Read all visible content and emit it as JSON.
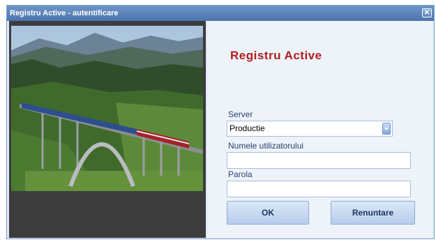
{
  "window": {
    "title": "Registru Active - autentificare"
  },
  "app": {
    "title": "Registru Active"
  },
  "form": {
    "server_label": "Server",
    "server_value": "Productie",
    "username_label": "Numele utilizatorului",
    "username_value": "",
    "password_label": "Parola",
    "password_value": ""
  },
  "buttons": {
    "ok": "OK",
    "cancel": "Renuntare"
  },
  "image": {
    "subject": "railway viaduct with train in mountain forest landscape"
  },
  "colors": {
    "title_bar": "#4b74ad",
    "app_title": "#b21d1d",
    "panel_background": "#eef3fa",
    "image_panel": "#3c3c3c"
  },
  "icons": {
    "close": "close-icon",
    "dropdown": "chevron-down-icon"
  }
}
